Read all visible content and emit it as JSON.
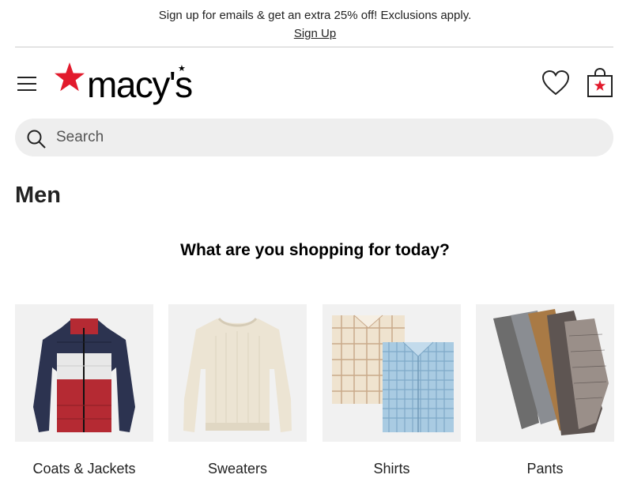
{
  "promo": {
    "text": "Sign up for emails & get an extra 25% off!  Exclusions apply.",
    "link": "Sign Up"
  },
  "header": {
    "logo_text": "macy's",
    "icons": [
      "menu-icon",
      "heart-icon",
      "shopping-bag-icon"
    ]
  },
  "search": {
    "placeholder": "Search"
  },
  "page": {
    "title": "Men",
    "section_heading": "What are you shopping for today?"
  },
  "categories": [
    {
      "label": "Coats & Jackets"
    },
    {
      "label": "Sweaters"
    },
    {
      "label": "Shirts"
    },
    {
      "label": "Pants"
    }
  ],
  "colors": {
    "brand_red": "#e21a2c",
    "search_bg": "#eeeeee",
    "text": "#222222"
  }
}
